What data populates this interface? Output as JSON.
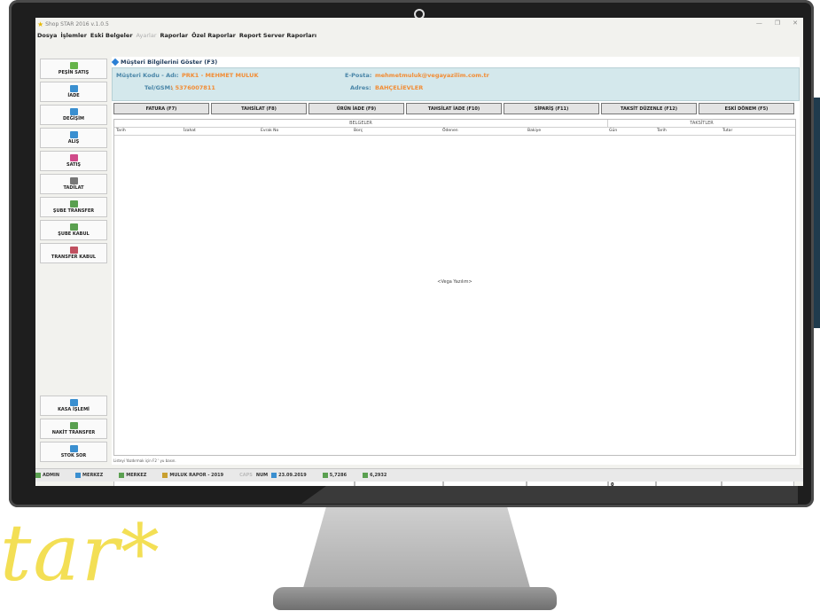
{
  "window": {
    "title": "Shop STAR 2016 v.1.0.5",
    "controls": [
      "—",
      "❐",
      "✕"
    ]
  },
  "menu": [
    {
      "label": "Dosya",
      "disabled": false
    },
    {
      "label": "İşlemler",
      "disabled": false
    },
    {
      "label": "Eski Belgeler",
      "disabled": false
    },
    {
      "label": "Ayarlar",
      "disabled": true
    },
    {
      "label": "Raporlar",
      "disabled": false
    },
    {
      "label": "Özel Raporlar",
      "disabled": false
    },
    {
      "label": "Report Server Raporları",
      "disabled": false
    }
  ],
  "sidebar": {
    "items": [
      {
        "label": "PEŞİN SATIŞ",
        "icon": "cash-register-icon",
        "color": "#66b34a"
      },
      {
        "label": "İADE",
        "icon": "return-icon",
        "color": "#3a8fd0"
      },
      {
        "label": "DEĞİŞİM",
        "icon": "exchange-icon",
        "color": "#3a8fd0"
      },
      {
        "label": "ALIŞ",
        "icon": "purchase-icon",
        "color": "#3a8fd0"
      },
      {
        "label": "SATIŞ",
        "icon": "sale-icon",
        "color": "#d04a8a"
      },
      {
        "label": "TADİLAT",
        "icon": "edit-icon",
        "color": "#777777"
      },
      {
        "label": "ŞUBE TRANSFER",
        "icon": "branch-transfer-icon",
        "color": "#5aa050"
      },
      {
        "label": "ŞUBE KABUL",
        "icon": "branch-accept-icon",
        "color": "#5aa050"
      },
      {
        "label": "TRANSFER KABUL",
        "icon": "transfer-accept-icon",
        "color": "#c05060"
      }
    ],
    "bottom": [
      {
        "label": "KASA İŞLEMİ",
        "icon": "cash-box-icon",
        "color": "#3a8fd0"
      },
      {
        "label": "NAKİT TRANSFER",
        "icon": "money-transfer-icon",
        "color": "#5aa050"
      },
      {
        "label": "STOK SOR",
        "icon": "stock-query-icon",
        "color": "#3a8fd0"
      }
    ]
  },
  "panel": {
    "title": "Müşteri Bilgilerini Göster (F3)"
  },
  "customer": {
    "code_label": "Müşteri Kodu - Adı:",
    "code_value": "PRK1 - MEHMET MULUK",
    "phone_label": "Tel/GSM:",
    "phone_value": "\\ 5376007811",
    "email_label": "E-Posta:",
    "email_value": "mehmetmuluk@vegayazilim.com.tr",
    "address_label": "Adres:",
    "address_value": "BAHÇELİEVLER"
  },
  "tabs": [
    "FATURA (F7)",
    "TAHSİLAT (F8)",
    "ÜRÜN İADE (F9)",
    "TAHSİLAT İADE (F10)",
    "SİPARİŞ (F11)",
    "TAKSİT DÜZENLE (F12)",
    "ESKİ DÖNEM (F5)"
  ],
  "grid": {
    "group1": "BELGELER",
    "group2": "TAKSİTLER",
    "columns": [
      "Tarih",
      "İzahat",
      "Evrak No",
      "Borç",
      "Ödenen",
      "Bakiye",
      "Gün",
      "Tarih",
      "Tutar"
    ],
    "watermark": "<Vega Yazılım>"
  },
  "summary": {
    "total": "0"
  },
  "hint": "Listeyi Yazdırmak için F2 ' yu basın.",
  "status": [
    {
      "label": "ADMIN",
      "icon": "user-icon",
      "color": "#5aa050"
    },
    {
      "label": "MERKEZ",
      "icon": "branch-icon",
      "color": "#3a8fd0"
    },
    {
      "label": "MERKEZ",
      "icon": "warehouse-icon",
      "color": "#5aa050"
    },
    {
      "label": "MULUK RAPOR - 2019",
      "icon": "report-icon",
      "color": "#c9a030"
    },
    {
      "label": "CAPS",
      "icon": "",
      "color": "#bbbbbb"
    },
    {
      "label": "NUM",
      "icon": "",
      "color": "#333333"
    },
    {
      "label": "23.09.2019",
      "icon": "calendar-icon",
      "color": "#3a8fd0"
    },
    {
      "label": "5,7286",
      "icon": "dollar-rate-icon",
      "color": "#5aa050"
    },
    {
      "label": "6,2932",
      "icon": "euro-rate-icon",
      "color": "#5aa050"
    }
  ],
  "brand": {
    "logo_text": "tar*"
  }
}
